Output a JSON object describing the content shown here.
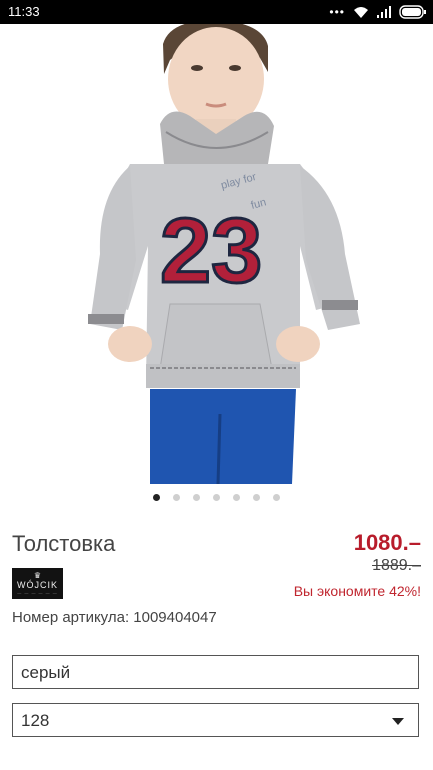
{
  "status_bar": {
    "time": "11:33",
    "icons": [
      "more-dots-icon",
      "wifi-icon",
      "signal-icon",
      "battery-icon"
    ]
  },
  "gallery": {
    "image_alt": "",
    "pages": 7,
    "active_page": 1,
    "print_text_1": "play for",
    "print_text_2": "fun",
    "print_number": "23"
  },
  "product": {
    "title": "Толстовка",
    "price": "1080.–",
    "old_price": "1889.–",
    "savings": "Вы экономите 42%!",
    "brand_name": "WÓJCIK",
    "sku_label": "Номер артикула: 1009404047"
  },
  "options": {
    "color_value": "серый",
    "size_value": "128"
  },
  "colors": {
    "price_red": "#b81c2b",
    "status_bar": "#000000",
    "pager_active": "#222222",
    "pager_inactive": "#cfcfcf"
  }
}
